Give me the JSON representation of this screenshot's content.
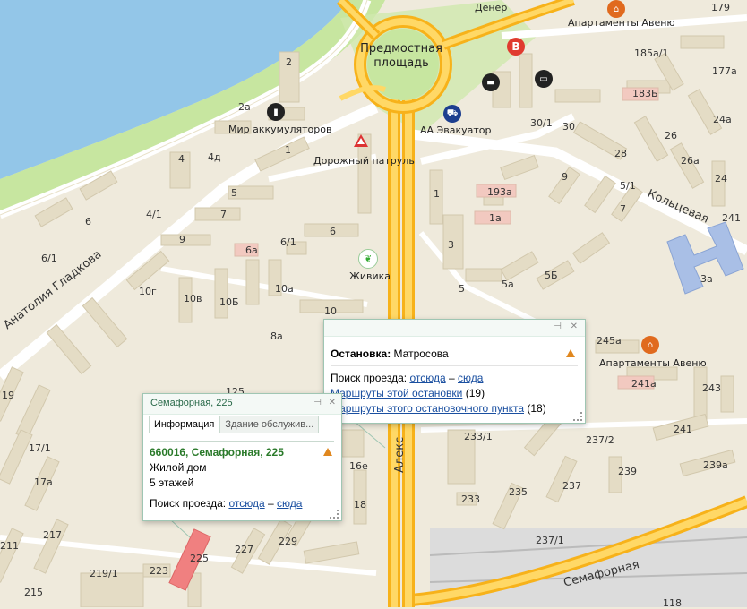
{
  "map": {
    "streets": {
      "gladkova": "Анатолия Гладкова",
      "koltsevaya": "Кольцевая",
      "semafornaya": "Семафорная",
      "alekseeva": "Алекс"
    },
    "places": {
      "square": "Предмостная площадь"
    },
    "pois": {
      "apartments_top": "Апартаменты Авеню",
      "apartments_right": "Апартаменты Авеню",
      "accumulators": "Мир аккумуляторов",
      "evacuator": "АА Эвакуатор",
      "patrol": "Дорожный патруль",
      "zhivika": "Живика",
      "dener": "Дёнер"
    },
    "house_numbers": {
      "h179": "179",
      "h185a1": "185а/1",
      "h177a": "177а",
      "h183b": "183Б",
      "h24a": "24а",
      "h301": "30/1",
      "h30": "30",
      "h26": "26",
      "h26a": "26а",
      "h28": "28",
      "h24": "24",
      "h241": "241",
      "h2": "2",
      "h2a": "2а",
      "h4": "4",
      "h4d": "4д",
      "h1a_top": "1",
      "h5_top": "5",
      "h41": "4/1",
      "h7": "7",
      "h6_left": "6",
      "h61_left": "6/1",
      "h9_left": "9",
      "h6a": "6а",
      "h61": "6/1",
      "h6": "6",
      "h193a": "193а",
      "h1": "1",
      "h1a": "1а",
      "h3": "3",
      "h9": "9",
      "h51": "5/1",
      "h7_right": "7",
      "h10g": "10г",
      "h10v": "10в",
      "h10b": "10Б",
      "h10a": "10а",
      "h10": "10",
      "h5": "5",
      "h5a": "5а",
      "h5b": "5Б",
      "h3a": "3а",
      "h245a": "245а",
      "h241a": "241а",
      "h243": "243",
      "h8a": "8а",
      "h19": "19",
      "h171": "17/1",
      "h17a": "17а",
      "h125": "125",
      "h16e": "16е",
      "h18": "18",
      "h2331": "233/1",
      "h2372": "237/2",
      "h239a": "239а",
      "h239": "239",
      "h237": "237",
      "h235": "235",
      "h233": "233",
      "h2371": "237/1",
      "h217": "217",
      "h211": "211",
      "h2191": "219/1",
      "h223": "223",
      "h225": "225",
      "h227": "227",
      "h229": "229",
      "h215": "215",
      "h118": "118"
    }
  },
  "popup_stop": {
    "label_bold": "Остановка:",
    "name": "Матросова",
    "route_search_label": "Поиск проезда:",
    "from_here": "отсюда",
    "dash": "–",
    "to_here": "сюда",
    "routes_stop_link": "Маршруты этой остановки",
    "routes_stop_count": "(19)",
    "routes_point_link": "Маршруты этого остановочного пункта",
    "routes_point_count": "(18)"
  },
  "popup_house": {
    "title": "Семафорная, 225",
    "tab_info": "Информация",
    "tab_service": "Здание обслужив...",
    "address": "660016, Семафорная, 225",
    "type": "Жилой дом",
    "floors": "5 этажей",
    "route_search_label": "Поиск проезда:",
    "from_here": "отсюда",
    "dash": "–",
    "to_here": "сюда"
  },
  "colors": {
    "background": "#efeadc",
    "water": "#93c6e8",
    "park": "#c7e6a0",
    "major_road": "#f7b21a",
    "building": "#e4dcc5",
    "highlight_building": "#f08080"
  }
}
